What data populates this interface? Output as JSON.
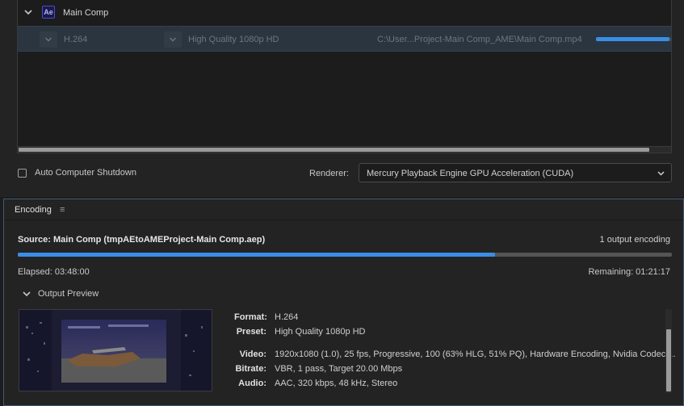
{
  "queue": {
    "comp_name": "Main Comp",
    "app_badge": "Ae",
    "output": {
      "format": "H.264",
      "preset": "High Quality 1080p HD",
      "path": "C:\\User...Project-Main Comp_AME\\Main Comp.mp4",
      "progress": 0.97
    },
    "auto_shutdown_label": "Auto Computer Shutdown",
    "renderer_label": "Renderer:",
    "renderer_value": "Mercury Playback Engine GPU Acceleration (CUDA)"
  },
  "encoding": {
    "tab_label": "Encoding",
    "tab_menu_icon": "≡",
    "source": "Source: Main Comp (tmpAEtoAMEProject-Main Comp.aep)",
    "output_count": "1 output encoding",
    "progress": 0.73,
    "elapsed": "Elapsed: 03:48:00",
    "remaining": "Remaining: 01:21:17",
    "output_preview_label": "Output Preview",
    "details": [
      {
        "key": "Format:",
        "value": "H.264"
      },
      {
        "key": "Preset:",
        "value": "High Quality 1080p HD"
      },
      {
        "key": "Video:",
        "value": "1920x1080 (1.0), 25 fps, Progressive, 100 (63% HLG, 51% PQ), Hardware Encoding, Nvidia Codec,..."
      },
      {
        "key": "Bitrate:",
        "value": "VBR, 1 pass, Target 20.00 Mbps"
      },
      {
        "key": "Audio:",
        "value": "AAC, 320 kbps, 48 kHz, Stereo"
      }
    ]
  },
  "colors": {
    "accent_blue": "#3a8ee6",
    "panel_bg": "#232323",
    "selected_row_bg": "#2a3540"
  }
}
